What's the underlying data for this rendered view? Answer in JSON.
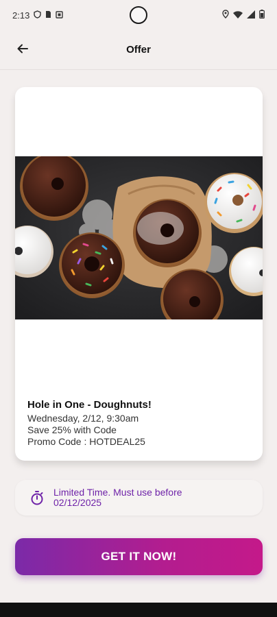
{
  "status_bar": {
    "time": "2:13",
    "left_icons": [
      "shield-icon",
      "sim-icon",
      "media-icon"
    ],
    "right_icons": [
      "location-icon",
      "wifi-icon",
      "signal-icon",
      "battery-icon"
    ]
  },
  "app_bar": {
    "title": "Offer",
    "back_icon": "arrow-left-icon"
  },
  "offer": {
    "image": "doughnuts-photo",
    "title": "Hole in One - Doughnuts!",
    "date": "Wednesday, 2/12, 9:30am",
    "discount": "Save 25% with Code",
    "promo": "Promo Code : HOTDEAL25"
  },
  "limited": {
    "icon": "timer-icon",
    "line1": "Limited Time. Must use before",
    "line2": "02/12/2025"
  },
  "cta": {
    "label": "GET IT NOW!"
  },
  "colors": {
    "accent_start": "#7b2aa8",
    "accent_end": "#c4198a",
    "limited_text": "#6e22a8",
    "background": "#f3efee"
  }
}
